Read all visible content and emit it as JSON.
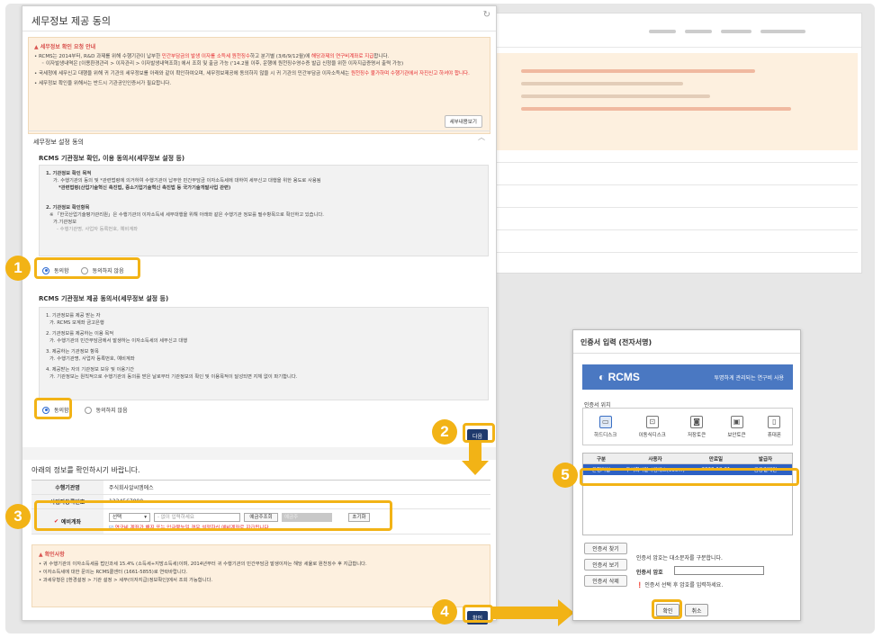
{
  "main_dialog": {
    "title": "세무정보 제공 동의",
    "notice": {
      "heading": "▲ 세무정보 확인 요청 안내",
      "line1_a": "• RCMS는 2014부터, R&D 과제를 위해 수행기관이 납부한 ",
      "line1_red": "민간부담금의 발생 이자를 소득세 원천징수",
      "line1_b": "하고 분기별 (3/6/9/12월)에 ",
      "line1_red2": "해당과제의 연구비계좌로 지급",
      "line1_c": "합니다.",
      "line2": "◦ 이자발생내역은 [이용환경관리 > 이자관리 > 이자발생내역조회] 에서 조회 및 출금 가능 ('14.2월 이후, 운행에 원천징수영수증 발급 신청을 위한 이자지급증명서 출력 가능)",
      "line3_a": "• 국세청에 세무신고 대행을 위해 귀 기관의 세무정보를 아래와 같이 확인하여오며, 세무정보제공에 동의하지 않을 시 귀 기관의 민간부담금 이자소득세는 ",
      "line3_red": "원천징수 불가하며 수행기관에서 자진신고 하셔야 합니다.",
      "line4": "• 세무정보 확인을 위해서는 반드시 기관공인인증서가 필요합니다.",
      "detail_button": "세부내용보기"
    },
    "consent_section_title": "세무정보 설정 동의",
    "consent1": {
      "heading": "RCMS 기관정보 확인, 이용 동의서(세무정보 설정 등)",
      "lines": [
        "1. 기관정보 확인 목적",
        "가. 수행기관의 동의 및 *관련법령에 의거하여 수행기관이 납부한 민간부담금 이자소득세에 대하여 세무신고 대행을 위한 용도로 사용됨",
        "*관련법령(산업기술혁신 촉진법, 중소기업기술혁신 촉진법 등 국가기술개발사업 관련)",
        "2. 기관정보 확인항목",
        "※ 「한국산업기술평가관리원」은 수행기관의 이자소득세 세무대행을 위해 아래와 같은 수행기관 정보를 필수항목으로 확인하고 있습니다.",
        "가.기관정보",
        "- 수행기관명, 사업자 등록번호, 예비계좌"
      ],
      "agree": "동의함",
      "disagree": "동의하지 않음"
    },
    "consent2": {
      "heading": "RCMS 기관정보 제공 동의서(세무정보 설정 등)",
      "lines": [
        "1. 기관정보를 제공 받는 자",
        "가. RCMS 모계좌 금고은행",
        "2. 기관정보를 제공하는 이용 목적",
        "가. 수행기관의 민간부담금에서 발생하는 이자소득세의 세무신고 대행",
        "3. 제공하는 기관정보 항목",
        "가. 수행기관명, 사업자 등록번호, 예비계좌",
        "4. 제공받는 자의 기관정보 보유 및 이용기간",
        "가. 기관정보는 원칙적으로 수행기관의 동의를 받은 날로부터 기관정보의 확인 및 이용목적이 달성되면 지체 없이 파기합니다."
      ],
      "agree": "동의함",
      "disagree": "동의하지 않음"
    },
    "next_button": "다음",
    "info": {
      "title": "아래의 정보를 확인하시기 바랍니다.",
      "org_label": "수행기관명",
      "org_value": "주식회사알씨엠에스",
      "bizno_label": "사업자등록번호",
      "bizno_value": "1234567890",
      "account_label": "예비계좌",
      "bank_select": "선택",
      "account_placeholder": "- 없이 입력하세요",
      "holder_button": "예금주조회",
      "holder_placeholder": "예금주",
      "reset_button": "초기화",
      "account_hint": "연구비 계좌가 해지 또는 입금불능일 경우 설정하신 예비계좌로 지급됩니다."
    },
    "confirm": {
      "heading": "▲ 확인사항",
      "line1": "• 귀 수행기관의 이자소득세를 법인과세 15.4% (소득세+지방소득세)이며, 2014년부터 귀 수행기관의 민간부담금 발생이자는 해당 세율로 원천징수 후 지급합니다.",
      "line2": "• 이자소득세에 대한 문의는 RCMS콜센터 (1661-5855)로 연락바랍니다.",
      "line3": "• 과세유형은 [환경설정 > 기관 설정 > 세무(이자지급)정보확인]에서 조회 가능합니다."
    },
    "ok_button": "확인"
  },
  "cert_dialog": {
    "title": "인증서 입력 (전자서명)",
    "banner_logo": "RCMS",
    "banner_slogan": "투명하게 관리되는 연구비 사용",
    "location_label": "인증서 위치",
    "locations": [
      "하드디스크",
      "이동식디스크",
      "저장토큰",
      "보안토큰",
      "휴대폰"
    ],
    "columns": [
      "구분",
      "사용자",
      "만료일",
      "발급자"
    ],
    "row": [
      "은행기업",
      "주식회사알씨엠에스(000...)",
      "2020-12-31",
      "금융결제원"
    ],
    "find_button": "인증서 찾기",
    "view_button": "인증서 보기",
    "delete_button": "인증서 삭제",
    "pw_hint": "인증서 암호는 대소문자를 구분합니다.",
    "pw_label": "인증서 암호",
    "pw_warn": "인증서 선택 후 암호를 입력하세요.",
    "ok_button": "확인",
    "cancel_button": "취소"
  },
  "step_badges": [
    "1",
    "2",
    "3",
    "4",
    "5"
  ],
  "colors": {
    "highlight": "#f2b316",
    "navy": "#1f3a6d",
    "selected_row": "#2d61c4"
  }
}
